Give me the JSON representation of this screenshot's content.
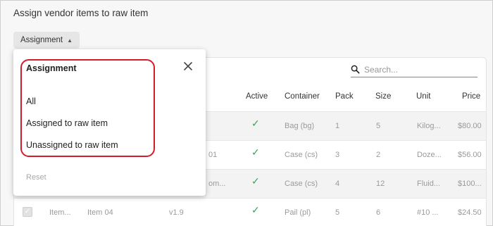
{
  "page": {
    "title": "Assign vendor items to raw item"
  },
  "filter": {
    "label": "Assignment"
  },
  "search": {
    "placeholder": "Search..."
  },
  "table": {
    "headers": {
      "active": "Active",
      "container": "Container",
      "pack": "Pack",
      "size": "Size",
      "unit": "Unit",
      "price": "Price"
    },
    "rows": [
      {
        "col1": "",
        "col2": "",
        "col3": "",
        "container": "Bag (bg)",
        "pack": "1",
        "size": "5",
        "unit": "Kilog...",
        "price": "$80.00"
      },
      {
        "col1": "",
        "col2": "",
        "col3": "01",
        "container": "Case (cs)",
        "pack": "3",
        "size": "2",
        "unit": "Doze...",
        "price": "$56.00"
      },
      {
        "col1": "",
        "col2": "",
        "col3": "om...",
        "container": "Case (cs)",
        "pack": "4",
        "size": "12",
        "unit": "Fluid...",
        "price": "$100..."
      },
      {
        "col1": "Item...",
        "col2": "Item 04",
        "col3": "v1.9",
        "container": "Pail (pl)",
        "pack": "5",
        "size": "6",
        "unit": "#10 ...",
        "price": "$24.50"
      }
    ]
  },
  "dropdown": {
    "title": "Assignment",
    "options": [
      "All",
      "Assigned to raw item",
      "Unassigned to raw item"
    ],
    "reset": "Reset"
  },
  "colors": {
    "highlight": "#d11d2a",
    "check": "#3da35d"
  }
}
